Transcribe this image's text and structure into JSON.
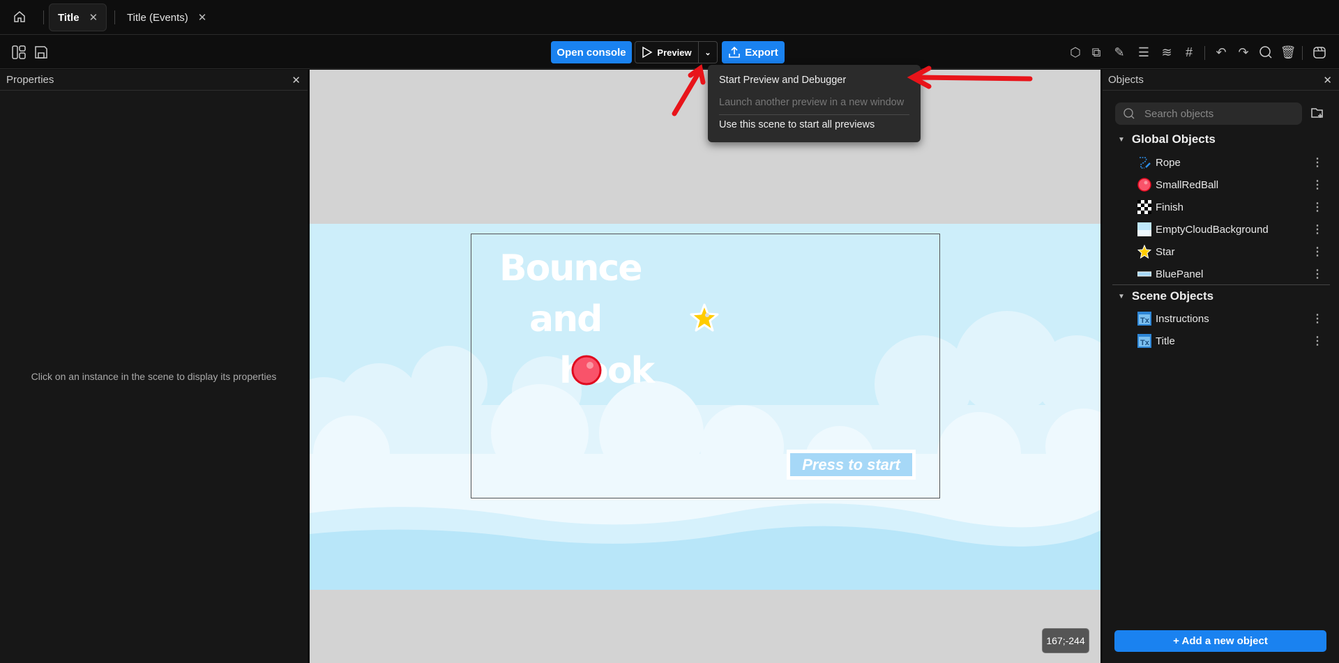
{
  "tabs": [
    {
      "label": "Title",
      "active": true
    },
    {
      "label": "Title (Events)",
      "active": false
    }
  ],
  "toolbar": {
    "open_console": "Open console",
    "preview": "Preview",
    "export": "Export"
  },
  "preview_menu": {
    "items": [
      {
        "label": "Start Preview and Debugger",
        "enabled": true
      },
      {
        "label": "Launch another preview in a new window",
        "enabled": false
      },
      {
        "label": "Use this scene to start all previews",
        "enabled": true
      }
    ]
  },
  "properties": {
    "title": "Properties",
    "empty_message": "Click on an instance in the scene to display its properties"
  },
  "objects": {
    "title": "Objects",
    "search_placeholder": "Search objects",
    "global_header": "Global Objects",
    "global_items": [
      {
        "label": "Rope",
        "icon": "rope-icon"
      },
      {
        "label": "SmallRedBall",
        "icon": "red-ball-icon"
      },
      {
        "label": "Finish",
        "icon": "checkered-flag-icon"
      },
      {
        "label": "EmptyCloudBackground",
        "icon": "cloud-background-icon"
      },
      {
        "label": "Star",
        "icon": "star-icon"
      },
      {
        "label": "BluePanel",
        "icon": "blue-panel-icon"
      }
    ],
    "scene_header": "Scene Objects",
    "scene_items": [
      {
        "label": "Instructions",
        "icon": "text-object-icon"
      },
      {
        "label": "Title",
        "icon": "text-object-icon"
      }
    ],
    "add_button": "+ Add a new object"
  },
  "scene": {
    "title_lines": [
      "Bounce",
      "and",
      "hook"
    ],
    "press_to_start": "Press to start",
    "cursor_coords": "167;-244"
  },
  "colors": {
    "accent": "#1a82f0",
    "annotation_arrow": "#e8141a",
    "sky": "#cdeefa"
  }
}
